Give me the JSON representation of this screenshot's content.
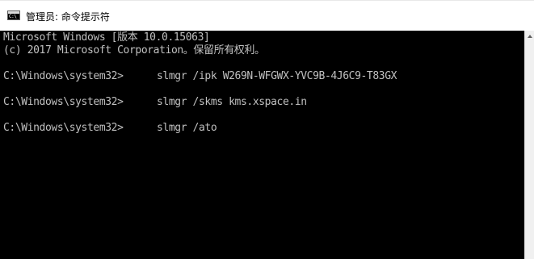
{
  "window": {
    "title": "管理员: 命令提示符",
    "icon": "cmd-icon",
    "icon_glyph": "C:\\"
  },
  "console": {
    "header_line_1": "Microsoft Windows [版本 10.0.15063]",
    "header_line_2": "(c) 2017 Microsoft Corporation。保留所有权利。",
    "commands": [
      {
        "prompt": "C:\\Windows\\system32>",
        "command": "slmgr /ipk W269N-WFGWX-YVC9B-4J6C9-T83GX"
      },
      {
        "prompt": "C:\\Windows\\system32>",
        "command": "slmgr /skms kms.xspace.in"
      },
      {
        "prompt": "C:\\Windows\\system32>",
        "command": "slmgr /ato"
      }
    ]
  },
  "colors": {
    "console_background": "#000000",
    "console_text": "#c0c0c0",
    "titlebar_background": "#ffffff"
  }
}
